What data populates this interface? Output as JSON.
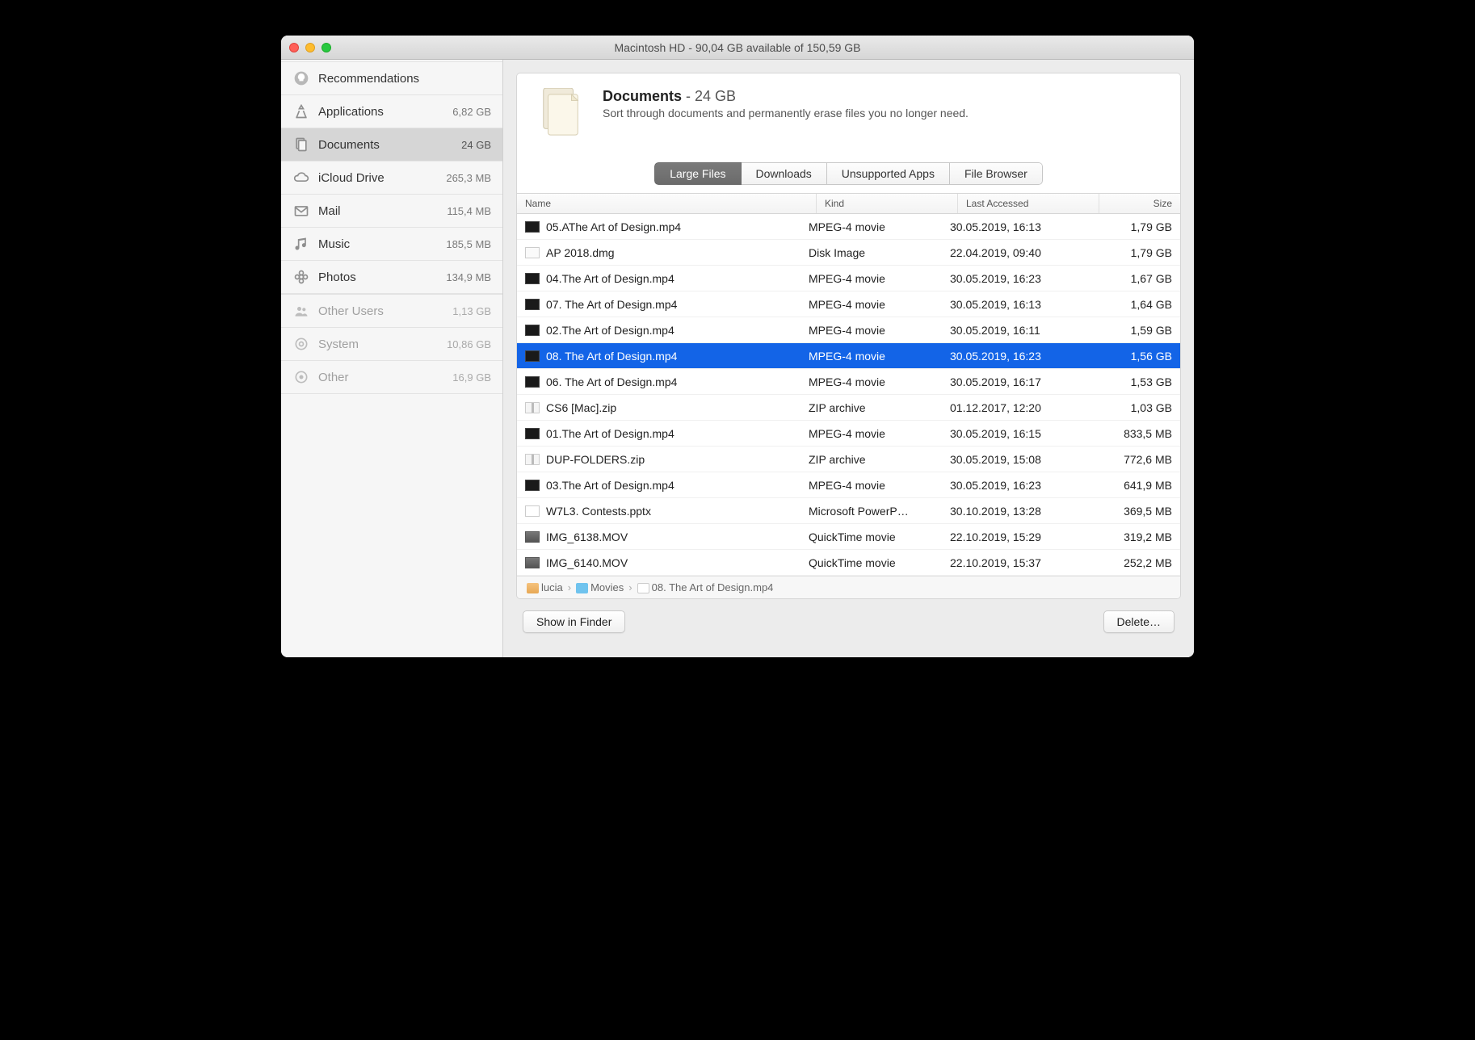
{
  "window": {
    "title": "Macintosh HD - 90,04 GB available of 150,59 GB"
  },
  "sidebar": {
    "items": [
      {
        "icon": "lightbulb-icon",
        "label": "Recommendations",
        "value": "",
        "disabled": false,
        "selected": false
      },
      {
        "icon": "apps-icon",
        "label": "Applications",
        "value": "6,82 GB",
        "disabled": false,
        "selected": false
      },
      {
        "icon": "docs-icon",
        "label": "Documents",
        "value": "24 GB",
        "disabled": false,
        "selected": true
      },
      {
        "icon": "cloud-icon",
        "label": "iCloud Drive",
        "value": "265,3 MB",
        "disabled": false,
        "selected": false
      },
      {
        "icon": "mail-icon",
        "label": "Mail",
        "value": "115,4 MB",
        "disabled": false,
        "selected": false
      },
      {
        "icon": "music-icon",
        "label": "Music",
        "value": "185,5 MB",
        "disabled": false,
        "selected": false
      },
      {
        "icon": "photos-icon",
        "label": "Photos",
        "value": "134,9 MB",
        "disabled": false,
        "selected": false
      },
      {
        "icon": "users-icon",
        "label": "Other Users",
        "value": "1,13 GB",
        "disabled": true,
        "selected": false
      },
      {
        "icon": "gear-icon",
        "label": "System",
        "value": "10,86 GB",
        "disabled": true,
        "selected": false
      },
      {
        "icon": "other-icon",
        "label": "Other",
        "value": "16,9 GB",
        "disabled": true,
        "selected": false
      }
    ]
  },
  "header": {
    "title": "Documents",
    "size": "24 GB",
    "desc": "Sort through documents and permanently erase files you no longer need."
  },
  "tabs": {
    "items": [
      {
        "label": "Large Files",
        "active": true
      },
      {
        "label": "Downloads",
        "active": false
      },
      {
        "label": "Unsupported Apps",
        "active": false
      },
      {
        "label": "File Browser",
        "active": false
      }
    ]
  },
  "columns": {
    "name": "Name",
    "kind": "Kind",
    "date": "Last Accessed",
    "size": "Size"
  },
  "files": [
    {
      "icon": "fi-video",
      "name": "05.AThe Art of Design.mp4",
      "kind": "MPEG-4 movie",
      "date": "30.05.2019, 16:13",
      "size": "1,79 GB",
      "selected": false
    },
    {
      "icon": "fi-dmg",
      "name": "AP 2018.dmg",
      "kind": "Disk Image",
      "date": "22.04.2019, 09:40",
      "size": "1,79 GB",
      "selected": false
    },
    {
      "icon": "fi-video",
      "name": "04.The Art of Design.mp4",
      "kind": "MPEG-4 movie",
      "date": "30.05.2019, 16:23",
      "size": "1,67 GB",
      "selected": false
    },
    {
      "icon": "fi-video",
      "name": "07. The Art of Design.mp4",
      "kind": "MPEG-4 movie",
      "date": "30.05.2019, 16:13",
      "size": "1,64 GB",
      "selected": false
    },
    {
      "icon": "fi-video",
      "name": "02.The Art of Design.mp4",
      "kind": "MPEG-4 movie",
      "date": "30.05.2019, 16:11",
      "size": "1,59 GB",
      "selected": false
    },
    {
      "icon": "fi-video",
      "name": "08. The Art of Design.mp4",
      "kind": "MPEG-4 movie",
      "date": "30.05.2019, 16:23",
      "size": "1,56 GB",
      "selected": true
    },
    {
      "icon": "fi-video",
      "name": "06. The Art of Design.mp4",
      "kind": "MPEG-4 movie",
      "date": "30.05.2019, 16:17",
      "size": "1,53 GB",
      "selected": false
    },
    {
      "icon": "fi-zip",
      "name": "CS6 [Mac].zip",
      "kind": "ZIP archive",
      "date": "01.12.2017, 12:20",
      "size": "1,03 GB",
      "selected": false
    },
    {
      "icon": "fi-video",
      "name": "01.The Art of Design.mp4",
      "kind": "MPEG-4 movie",
      "date": "30.05.2019, 16:15",
      "size": "833,5 MB",
      "selected": false
    },
    {
      "icon": "fi-zip",
      "name": "DUP-FOLDERS.zip",
      "kind": "ZIP archive",
      "date": "30.05.2019, 15:08",
      "size": "772,6 MB",
      "selected": false
    },
    {
      "icon": "fi-video",
      "name": "03.The Art of Design.mp4",
      "kind": "MPEG-4 movie",
      "date": "30.05.2019, 16:23",
      "size": "641,9 MB",
      "selected": false
    },
    {
      "icon": "fi-pptx",
      "name": "W7L3. Contests.pptx",
      "kind": "Microsoft PowerP…",
      "date": "30.10.2019, 13:28",
      "size": "369,5 MB",
      "selected": false
    },
    {
      "icon": "fi-mov",
      "name": "IMG_6138.MOV",
      "kind": "QuickTime movie",
      "date": "22.10.2019, 15:29",
      "size": "319,2 MB",
      "selected": false
    },
    {
      "icon": "fi-mov",
      "name": "IMG_6140.MOV",
      "kind": "QuickTime movie",
      "date": "22.10.2019, 15:37",
      "size": "252,2 MB",
      "selected": false
    }
  ],
  "path": {
    "segments": [
      {
        "icon": "pi-home",
        "label": "lucia"
      },
      {
        "icon": "pi-folder",
        "label": "Movies"
      },
      {
        "icon": "pi-file",
        "label": "08. The Art of Design.mp4"
      }
    ]
  },
  "buttons": {
    "show": "Show in Finder",
    "delete": "Delete…"
  }
}
